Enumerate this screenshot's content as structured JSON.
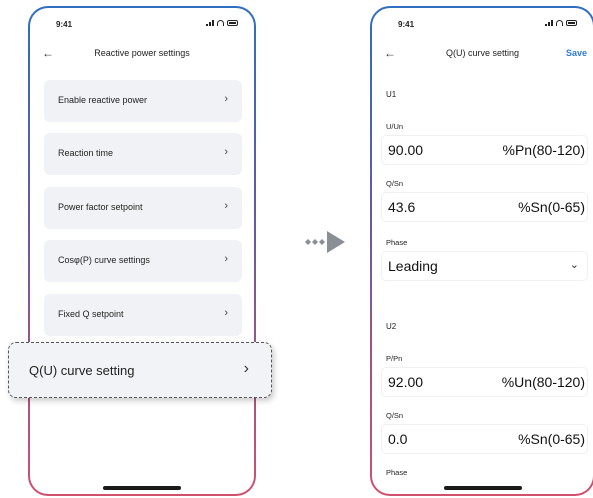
{
  "left_screen": {
    "status_time": "9:41",
    "title": "Reactive power settings",
    "menu_items": [
      {
        "label": "Enable reactive power"
      },
      {
        "label": "Reaction time"
      },
      {
        "label": "Power factor setpoint"
      },
      {
        "label": "Cosφ(P) curve settings"
      },
      {
        "label": "Fixed Q setpoint"
      }
    ],
    "highlight_item": {
      "label": "Q(U) curve setting"
    }
  },
  "right_screen": {
    "status_time": "9:41",
    "title": "Q(U) curve setting",
    "save_label": "Save",
    "u1": {
      "section": "U1",
      "u_un_caption": "U/Un",
      "u_un_value": "90.00",
      "u_un_unit": "%Pn(80-120)",
      "q_sn_caption": "Q/Sn",
      "q_sn_value": "43.6",
      "q_sn_unit": "%Sn(0-65)",
      "phase_caption": "Phase",
      "phase_value": "Leading"
    },
    "u2": {
      "section": "U2",
      "p_pn_caption": "P/Pn",
      "p_pn_value": "92.00",
      "p_pn_unit": "%Un(80-120)",
      "q_sn_caption": "Q/Sn",
      "q_sn_value": "0.0",
      "q_sn_unit": "%Sn(0-65)",
      "phase_caption": "Phase"
    }
  },
  "icons": {
    "back": "back-arrow-icon",
    "chevron_right": "chevron-right-icon",
    "chevron_down": "chevron-down-icon",
    "transition": "transition-arrow-icon"
  },
  "colors": {
    "accent": "#2e7bd3",
    "frame_top": "#2f6fc0",
    "frame_bottom": "#d0506e",
    "card_bg": "#f0f2f5"
  }
}
